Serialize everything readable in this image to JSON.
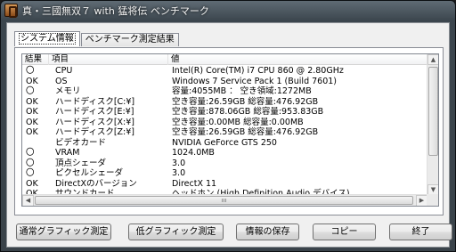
{
  "window": {
    "title": "真・三國無双７ with 猛将伝 ベンチマーク"
  },
  "tabs": [
    {
      "label": "システム情報",
      "active": true
    },
    {
      "label": "ベンチマーク測定結果",
      "active": false
    }
  ],
  "table": {
    "columns": [
      "結果",
      "項目",
      "値"
    ],
    "rows": [
      {
        "result": "〇",
        "item": "CPU",
        "value": "Intel(R) Core(TM) i7 CPU         860  @ 2.80GHz"
      },
      {
        "result": "OK",
        "item": "OS",
        "value": "Windows 7 Service Pack 1 (Build 7601)"
      },
      {
        "result": "〇",
        "item": "メモリ",
        "value": "容量:4055MB ： 空き領域:1272MB"
      },
      {
        "result": "OK",
        "item": "ハードディスク[C:¥]",
        "value": "空き容量:26.59GB  総容量:476.92GB"
      },
      {
        "result": "OK",
        "item": "ハードディスク[E:¥]",
        "value": "空き容量:878.06GB  総容量:953.83GB"
      },
      {
        "result": "OK",
        "item": "ハードディスク[X:¥]",
        "value": "空き容量:0.00MB  総容量:0.00MB"
      },
      {
        "result": "OK",
        "item": "ハードディスク[Z:¥]",
        "value": "空き容量:26.59GB  総容量:476.92GB"
      },
      {
        "result": "",
        "item": "ビデオカード",
        "value": "NVIDIA GeForce GTS 250"
      },
      {
        "result": "〇",
        "item": "VRAM",
        "value": "1024.0MB"
      },
      {
        "result": "〇",
        "item": "頂点シェーダ",
        "value": "3.0"
      },
      {
        "result": "〇",
        "item": "ピクセルシェーダ",
        "value": "3.0"
      },
      {
        "result": "OK",
        "item": "DirectXのバージョン",
        "value": "DirectX 11"
      },
      {
        "result": "OK",
        "item": "サウンドカード",
        "value": "ヘッドホン (High Definition Audio デバイス)"
      }
    ]
  },
  "scrollbar": {
    "grip": "ııı"
  },
  "buttons": {
    "normal_graphics": "通常グラフィック測定",
    "low_graphics": "低グラフィック測定",
    "save_info": "情報の保存",
    "copy": "コピー",
    "exit": "終了"
  },
  "icons": {
    "app": "musou-app-icon",
    "scroll_up": "arrow-up-icon",
    "scroll_down": "arrow-down-icon",
    "scroll_left": "arrow-left-icon",
    "scroll_right": "arrow-right-icon"
  }
}
